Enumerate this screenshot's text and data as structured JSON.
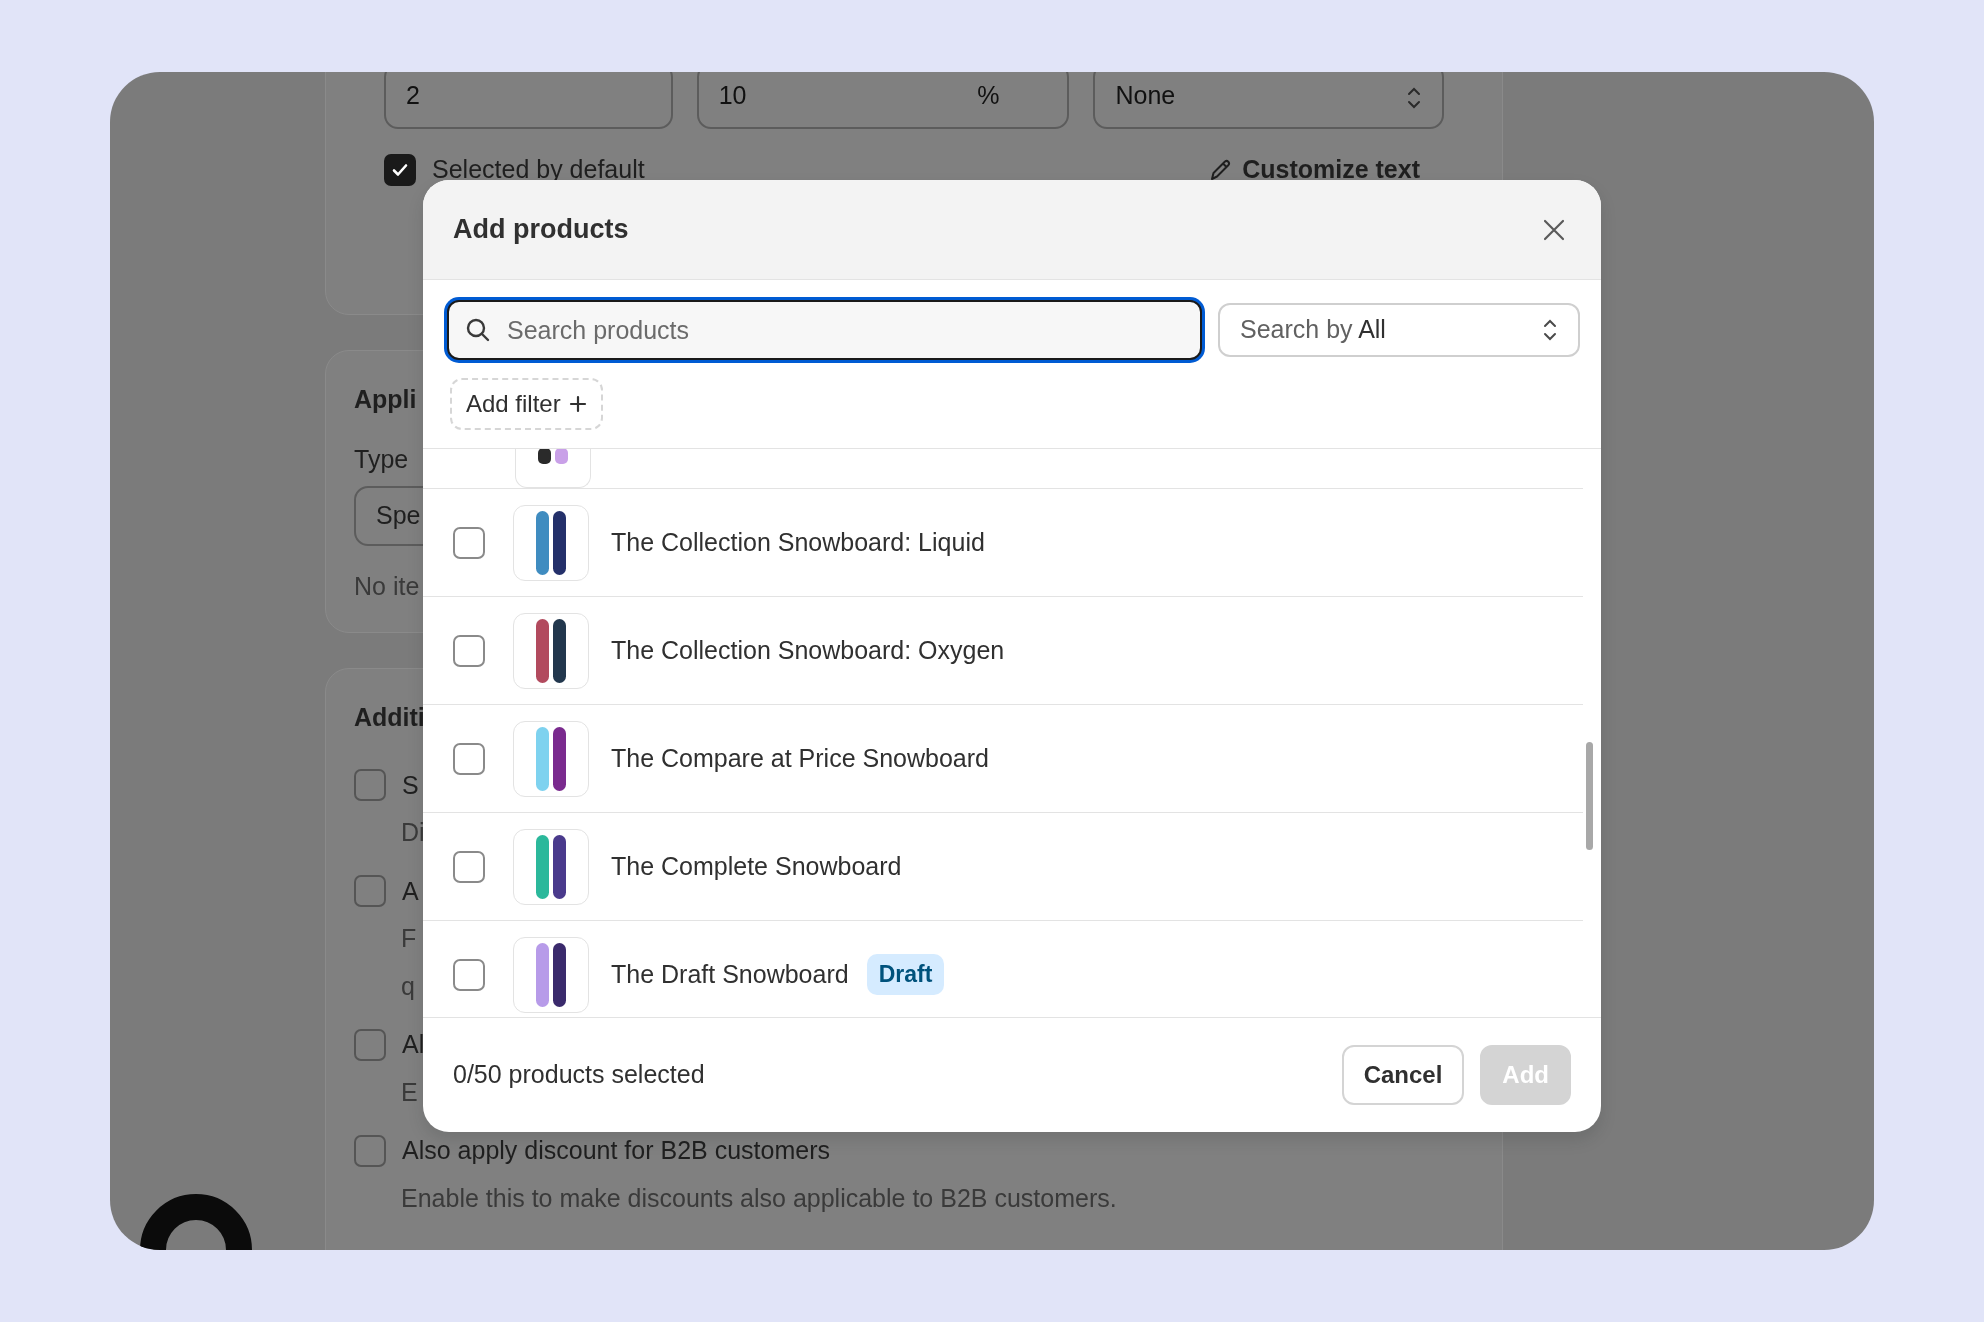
{
  "background_form": {
    "fields": [
      {
        "kind": "text",
        "value": "2"
      },
      {
        "kind": "suffix",
        "value": "10",
        "suffix": "%"
      },
      {
        "kind": "select",
        "value": "None"
      }
    ],
    "default_option": {
      "label": "Selected by default",
      "checked": true
    },
    "customize_text": "Customize text",
    "applies_section": {
      "title": "Appli",
      "type_label": "Type",
      "type_value": "Spe",
      "note": "No ite"
    },
    "additional_section": {
      "title": "Additi",
      "options": [
        {
          "label": "S",
          "checked": false,
          "help": [
            "Di"
          ]
        },
        {
          "label": "A",
          "checked": false,
          "help": [
            "F",
            "q"
          ]
        },
        {
          "label": "Al",
          "checked": false,
          "help": [
            "E"
          ]
        },
        {
          "label": "Also apply discount for B2B customers",
          "checked": false,
          "help": [
            "Enable this to make discounts also applicable to B2B customers."
          ]
        }
      ]
    }
  },
  "modal": {
    "title": "Add products",
    "search": {
      "placeholder": "Search products"
    },
    "search_by": {
      "label": "Search by",
      "value": "All"
    },
    "add_filter": "Add filter",
    "products": [
      {
        "name": "The Collection Snowboard: Liquid",
        "checked": false
      },
      {
        "name": "The Collection Snowboard: Oxygen",
        "checked": false
      },
      {
        "name": "The Compare at Price Snowboard",
        "checked": false
      },
      {
        "name": "The Complete Snowboard",
        "checked": false
      },
      {
        "name": "The Draft Snowboard",
        "checked": false,
        "badge": "Draft"
      }
    ],
    "footer": {
      "selection": "0/50 products selected",
      "buttons": [
        {
          "label": "Cancel",
          "kind": "secondary",
          "disabled": false
        },
        {
          "label": "Add",
          "kind": "primary",
          "disabled": true
        }
      ]
    }
  }
}
